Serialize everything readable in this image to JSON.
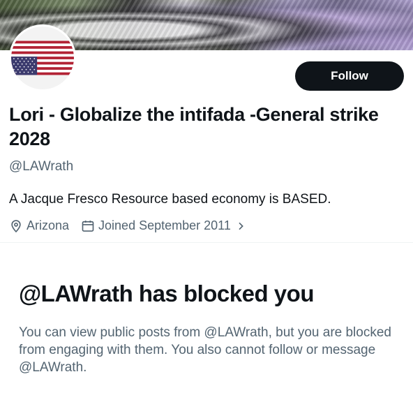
{
  "banner": {
    "description_icon": "banner-image"
  },
  "profile": {
    "avatar_icon": "us-flag-upside-down-icon",
    "follow_label": "Follow",
    "display_name": "Lori - Globalize the intifada -General strike 2028",
    "handle": "@LAWrath",
    "bio": "A Jacque Fresco Resource based economy is BASED.",
    "location": "Arizona",
    "joined": "Joined September 2011",
    "location_icon": "location-pin-icon",
    "calendar_icon": "calendar-icon",
    "chevron_icon": "chevron-right-icon"
  },
  "blocked": {
    "title": "@LAWrath has blocked you",
    "description": "You can view public posts from @LAWrath, but you are blocked from engaging with them. You also cannot follow or message @LAWrath."
  },
  "colors": {
    "primary_text": "#0f1419",
    "secondary_text": "#536471",
    "button_bg": "#0f1419",
    "flag_red": "#b22234",
    "flag_blue": "#3c3b6e"
  }
}
